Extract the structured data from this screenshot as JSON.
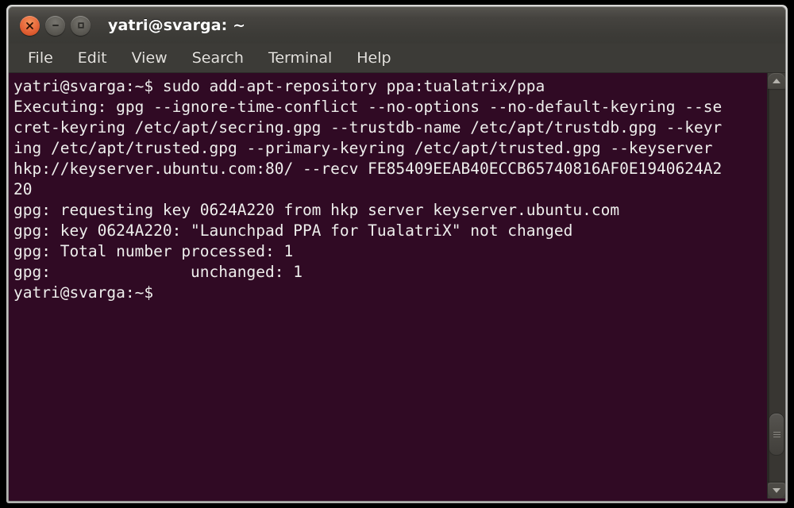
{
  "window": {
    "title": "yatri@svarga: ~",
    "buttons": [
      {
        "name": "close",
        "icon": "close-icon",
        "label": "Close"
      },
      {
        "name": "minimize",
        "icon": "minimize-icon",
        "label": "Minimize"
      },
      {
        "name": "maximize",
        "icon": "maximize-icon",
        "label": "Maximize"
      }
    ]
  },
  "menubar": {
    "items": [
      {
        "label": "File"
      },
      {
        "label": "Edit"
      },
      {
        "label": "View"
      },
      {
        "label": "Search"
      },
      {
        "label": "Terminal"
      },
      {
        "label": "Help"
      }
    ]
  },
  "terminal": {
    "background_color": "#300a24",
    "foreground_color": "#eeeeec",
    "prompt": "yatri@svarga:~$",
    "command": "sudo add-apt-repository ppa:tualatrix/ppa",
    "lines": [
      "yatri@svarga:~$ sudo add-apt-repository ppa:tualatrix/ppa",
      "Executing: gpg --ignore-time-conflict --no-options --no-default-keyring --se",
      "cret-keyring /etc/apt/secring.gpg --trustdb-name /etc/apt/trustdb.gpg --keyr",
      "ing /etc/apt/trusted.gpg --primary-keyring /etc/apt/trusted.gpg --keyserver",
      "hkp://keyserver.ubuntu.com:80/ --recv FE85409EEAB40ECCB65740816AF0E1940624A2",
      "20",
      "gpg: requesting key 0624A220 from hkp server keyserver.ubuntu.com",
      "gpg: key 0624A220: \"Launchpad PPA for TualatriX\" not changed",
      "gpg: Total number processed: 1",
      "gpg:               unchanged: 1",
      "yatri@svarga:~$"
    ]
  },
  "scrollbar": {
    "up_arrow": "arrow-up-icon",
    "down_arrow": "arrow-down-icon",
    "thumb": "scrollbar-thumb"
  }
}
